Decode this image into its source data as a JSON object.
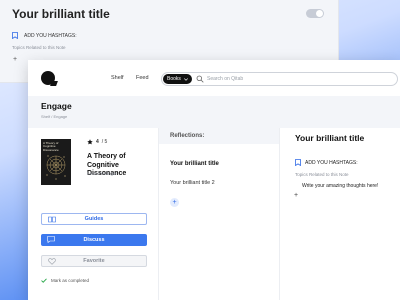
{
  "background_note": {
    "title": "Your brilliant title",
    "hashtag_label": "ADD YOU HASHTAGS:",
    "topics_label": "Topics Related to this Note",
    "add_symbol": "+"
  },
  "nav": {
    "shelf": "Shelf",
    "feed": "Feed"
  },
  "search": {
    "scope": "Books",
    "placeholder": "Search on Qitab"
  },
  "page": {
    "title": "Engage",
    "breadcrumb": "Shelf / Engage"
  },
  "book": {
    "cover_title": "A Theory of Cognitive Dissonance",
    "cover_author": "LEON FESTINGER",
    "rating": "4",
    "rating_max": "/ 5",
    "title": "A Theory of Cognitive Dissonance",
    "author": "Leon Festinger"
  },
  "actions": {
    "guides": "Guides",
    "discuss": "Discuss",
    "favorite": "Favorite",
    "mark_completed": "Mark as completed"
  },
  "reflections": {
    "label": "Reflections:",
    "items": [
      "Your brilliant title",
      "Your brilliant title 2"
    ],
    "add_symbol": "+"
  },
  "note": {
    "title": "Your brilliant title",
    "hashtag_label": "ADD YOU HASHTAGS:",
    "topics_label": "Topics Related to this Note",
    "body": "Write your amazing thoughts here!",
    "add_symbol": "+"
  },
  "colors": {
    "accent": "#3b78ee",
    "accent_light": "#e2ebfd",
    "check": "#2aa84a"
  }
}
